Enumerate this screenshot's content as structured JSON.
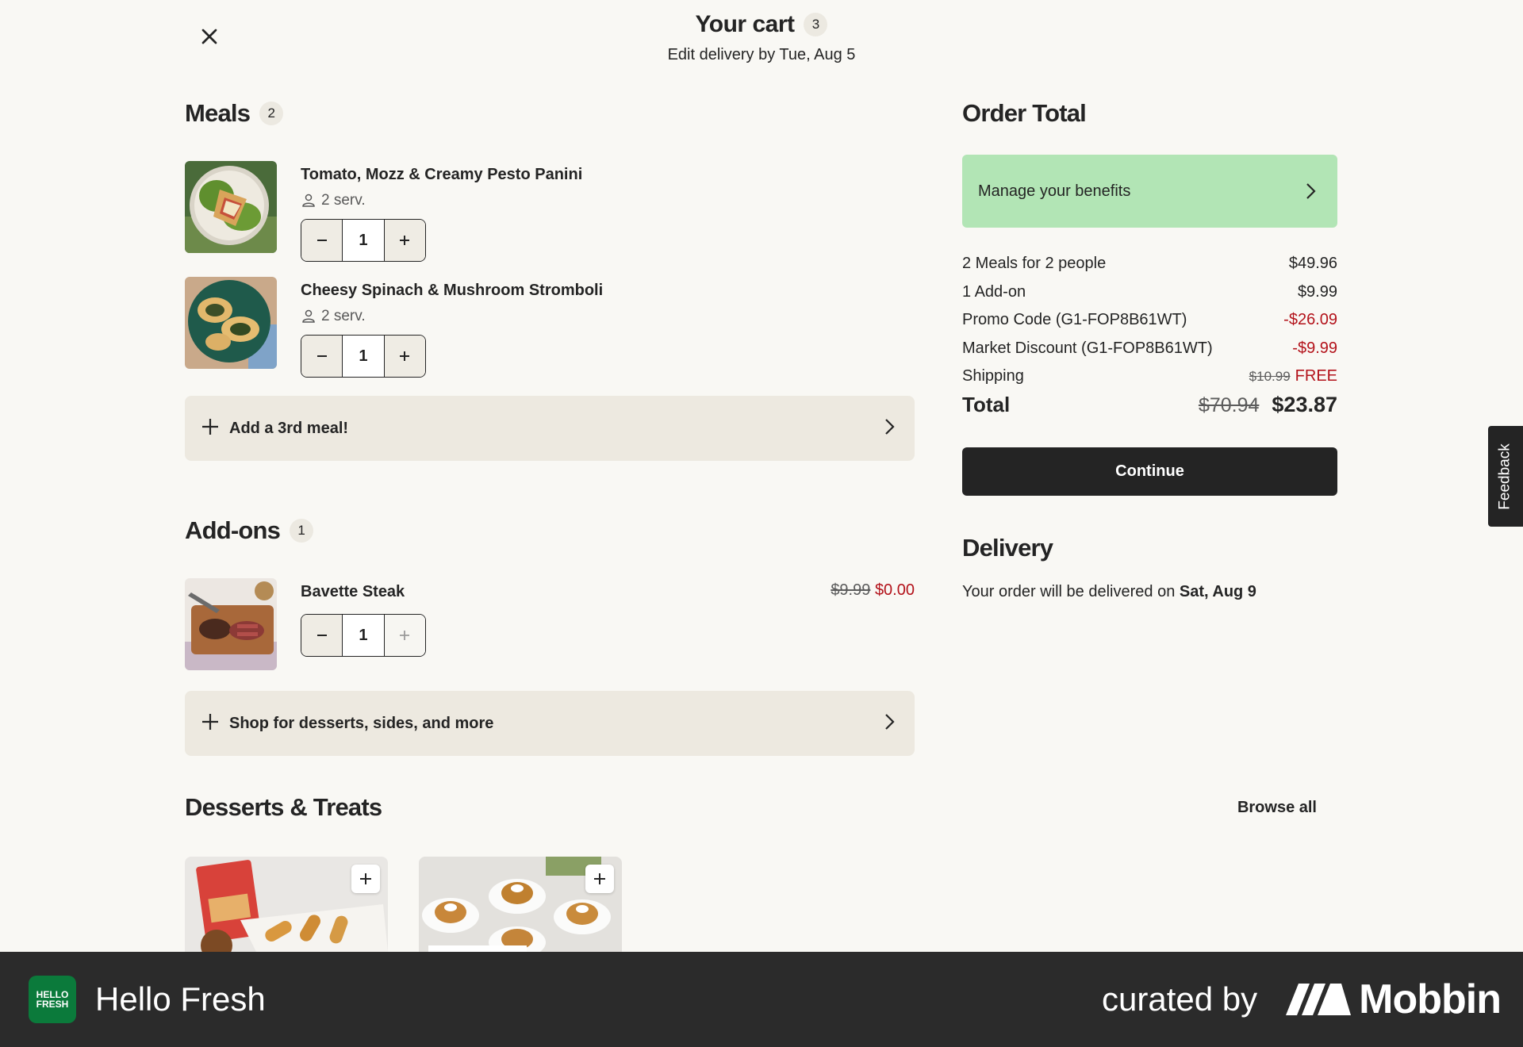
{
  "header": {
    "title": "Your cart",
    "count": "3",
    "subtitle": "Edit delivery by Tue, Aug 5"
  },
  "meals": {
    "title": "Meals",
    "count": "2",
    "items": [
      {
        "name": "Tomato, Mozz & Creamy Pesto Panini",
        "servings": "2 serv.",
        "quantity": "1"
      },
      {
        "name": "Cheesy Spinach & Mushroom Stromboli",
        "servings": "2 serv.",
        "quantity": "1"
      }
    ],
    "add_label": "Add a 3rd meal!"
  },
  "addons": {
    "title": "Add-ons",
    "count": "1",
    "items": [
      {
        "name": "Bavette Steak",
        "quantity": "1",
        "old_price": "$9.99",
        "price": "$0.00"
      }
    ],
    "shop_label": "Shop for desserts, sides, and more"
  },
  "desserts": {
    "title": "Desserts & Treats",
    "browse_label": "Browse all"
  },
  "order": {
    "title": "Order Total",
    "benefits_label": "Manage your benefits",
    "lines": [
      {
        "label": "2 Meals for 2 people",
        "value": "$49.96"
      },
      {
        "label": "1 Add-on",
        "value": "$9.99"
      },
      {
        "label": "Promo Code (G1-FOP8B61WT)",
        "value": "-$26.09"
      },
      {
        "label": "Market Discount (G1-FOP8B61WT)",
        "value": "-$9.99"
      }
    ],
    "shipping_label": "Shipping",
    "shipping_old": "$10.99",
    "shipping_value": "FREE",
    "total_label": "Total",
    "total_old": "$70.94",
    "total_value": "$23.87",
    "continue_label": "Continue"
  },
  "delivery": {
    "title": "Delivery",
    "text": "Your order will be delivered on ",
    "date": "Sat, Aug 9"
  },
  "feedback_label": "Feedback",
  "footer": {
    "app_name": "Hello Fresh",
    "logo_line1": "HELLO",
    "logo_line2": "FRESH",
    "curated_label": "curated by",
    "brand": "Mobbin"
  },
  "colors": {
    "background": "#f9f8f4",
    "benefits_green": "#b2e5b5",
    "discount_red": "#b3121a",
    "button_dark": "#242424",
    "cta_beige": "#ede9e0",
    "footer_bg": "#2b2b2b"
  }
}
